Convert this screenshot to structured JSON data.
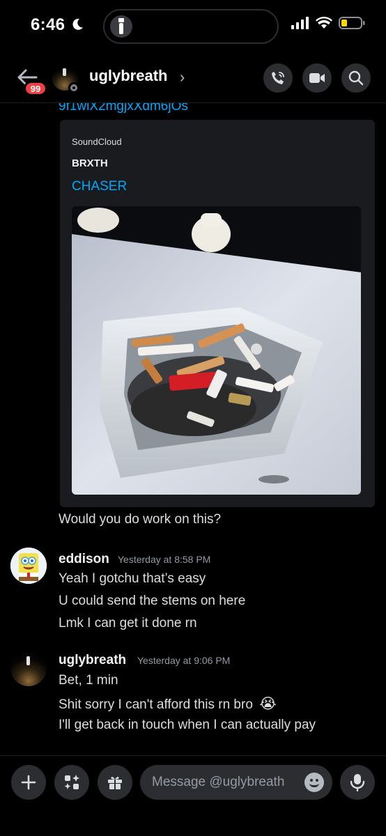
{
  "status_bar": {
    "time": "6:46"
  },
  "header": {
    "unread_badge": "99",
    "username": "uglybreath",
    "chevron": "›"
  },
  "chat": {
    "cut_link": "9f1wiX2mgjxXdm6jOs",
    "embed": {
      "provider": "SoundCloud",
      "author": "BRXTH",
      "title": "CHASER"
    },
    "messages": [
      {
        "text": "Would you do work on this?"
      }
    ],
    "groups": [
      {
        "author": "eddison",
        "timestamp": "Yesterday at 8:58 PM",
        "lines": [
          "Yeah I gotchu that’s easy",
          "U could send the stems on here",
          "Lmk I can get it done rn"
        ]
      },
      {
        "author": "uglybreath",
        "timestamp": "Yesterday at 9:06 PM",
        "lines": [
          "Bet, 1 min",
          "Shit sorry I can't afford this rn bro",
          "I'll get back in touch when I can actually pay"
        ],
        "emoji": "😭"
      }
    ]
  },
  "input": {
    "placeholder": "Message @uglybreath"
  },
  "icons": {
    "back": "arrow-left-icon",
    "call": "phone-icon",
    "video": "video-camera-icon",
    "search": "search-icon",
    "plus": "plus-icon",
    "apps": "apps-icon",
    "gift": "gift-icon",
    "emoji": "emoji-icon",
    "mic": "microphone-icon"
  },
  "colors": {
    "link": "#00a8fc",
    "badge": "#f23f43",
    "surface": "#2b2d31",
    "background": "#000000"
  }
}
